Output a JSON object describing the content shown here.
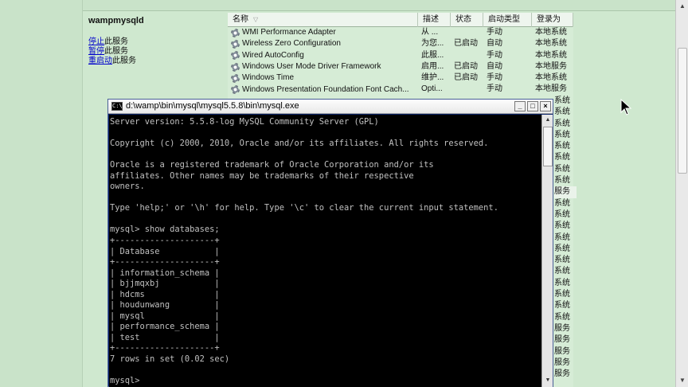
{
  "services_panel": {
    "service_title": "wampmysqld",
    "actions": [
      {
        "link": "停止",
        "rest": "此服务"
      },
      {
        "link": "暂停",
        "rest": "此服务"
      },
      {
        "link": "重启动",
        "rest": "此服务"
      }
    ],
    "columns": {
      "name": "名称",
      "desc": "描述",
      "state": "状态",
      "start": "启动类型",
      "logon": "登录为"
    },
    "rows": [
      {
        "name": "WMI Performance Adapter",
        "desc": "从 ...",
        "state": "",
        "start": "手动",
        "logon": "本地系统"
      },
      {
        "name": "Wireless Zero Configuration",
        "desc": "为您...",
        "state": "已启动",
        "start": "自动",
        "logon": "本地系统"
      },
      {
        "name": "Wired AutoConfig",
        "desc": "此服...",
        "state": "",
        "start": "手动",
        "logon": "本地系统"
      },
      {
        "name": "Windows User Mode Driver Framework",
        "desc": "启用...",
        "state": "已启动",
        "start": "自动",
        "logon": "本地服务"
      },
      {
        "name": "Windows Time",
        "desc": "维护...",
        "state": "已启动",
        "start": "手动",
        "logon": "本地系统"
      },
      {
        "name": "Windows Presentation Foundation Font Cach...",
        "desc": "Opti...",
        "state": "",
        "start": "手动",
        "logon": "本地服务"
      }
    ],
    "logon_visible_col": [
      "系统",
      "系统",
      "系统",
      "系统",
      "系统",
      "系统",
      "系统",
      "系统",
      "服务",
      "系统",
      "系统",
      "系统",
      "系统",
      "系统",
      "系统",
      "系统",
      "系统",
      "系统",
      "系统",
      "系统",
      "服务",
      "服务",
      "服务",
      "服务",
      "服务"
    ]
  },
  "console": {
    "title": "d:\\wamp\\bin\\mysql\\mysql5.5.8\\bin\\mysql.exe",
    "icon_text": "C:\\",
    "minimize_glyph": "_",
    "maximize_glyph": "□",
    "close_glyph": "×",
    "output": "Server version: 5.5.8-log MySQL Community Server (GPL)\n\nCopyright (c) 2000, 2010, Oracle and/or its affiliates. All rights reserved.\n\nOracle is a registered trademark of Oracle Corporation and/or its\naffiliates. Other names may be trademarks of their respective\nowners.\n\nType 'help;' or '\\h' for help. Type '\\c' to clear the current input statement.\n\nmysql> show databases;\n+--------------------+\n| Database           |\n+--------------------+\n| information_schema |\n| bjjmqxbj           |\n| hdcms              |\n| houdunwang         |\n| mysql              |\n| performance_schema |\n| test               |\n+--------------------+\n7 rows in set (0.02 sec)\n\nmysql>"
  },
  "icons": {
    "service_row": "gear-icon",
    "console_app": "console-icon",
    "pointer": "mouse-cursor-icon"
  },
  "colors": {
    "services_bg": "#cfe8cf",
    "console_bg": "#000000",
    "console_text": "#c0c0c0",
    "link": "#0000cc"
  }
}
